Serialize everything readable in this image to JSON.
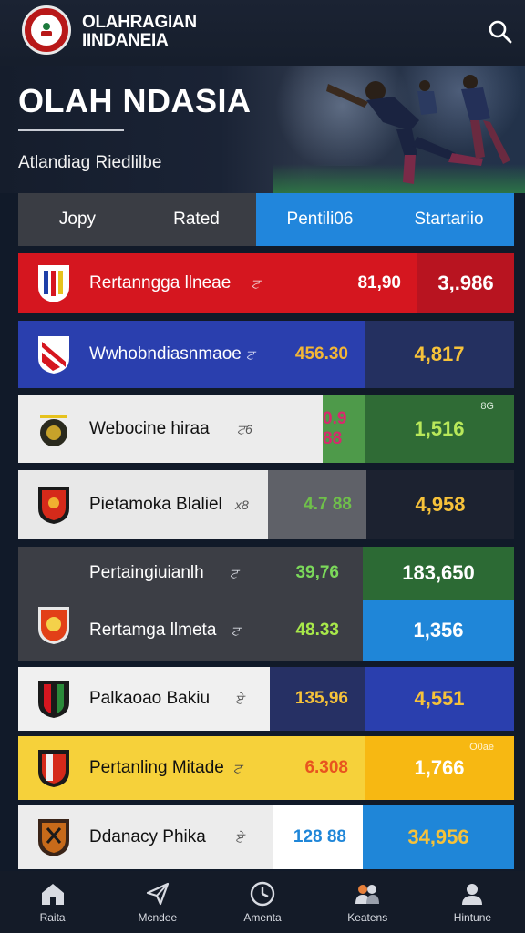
{
  "app": {
    "title_line1": "OLAHRAGIAN",
    "title_line2": "IINDANEIA"
  },
  "icons": {
    "search": "search-icon",
    "home": "home-icon",
    "matches": "paper-plane-icon",
    "schedule": "clock-icon",
    "teams": "users-icon",
    "profile": "person-icon"
  },
  "hero": {
    "title": "OLAH NDASIA",
    "subtitle": "Atlandiag Riedlilbe"
  },
  "table": {
    "headers": [
      "Jopy",
      "Rated",
      "Pentili06",
      "Startariio"
    ],
    "rows": [
      {
        "name": "Rertanngga llneae",
        "code": "ਟ",
        "value": "81,90",
        "score": "3,.986",
        "label": ""
      },
      {
        "name": "Wwhobndiasnmaoe",
        "code": "ਟ",
        "value": "456.30",
        "score": "4,817",
        "label": ""
      },
      {
        "name": "Webocine hiraa",
        "code": "ਟ6",
        "value": "0.9 88",
        "score": "1,516",
        "label": "8G"
      },
      {
        "name": "Pietamoka Blaliel",
        "code": "x8",
        "value": "4.7 88",
        "score": "4,958",
        "label": ""
      },
      {
        "name": "Pertaingiuianlh",
        "code": "ਟ",
        "value": "39,76",
        "score": "183,650",
        "label": ""
      },
      {
        "name": "Rertamga llmeta",
        "code": "ਟ",
        "value": "48.33",
        "score": "1,356",
        "label": ""
      },
      {
        "name": "Palkaoao Bakiu",
        "code": "ਏ",
        "value": "135,96",
        "score": "4,551",
        "label": ""
      },
      {
        "name": "Pertanling Mitade",
        "code": "ਟ",
        "value": "6.308",
        "score": "1,766",
        "label": "O0ae"
      },
      {
        "name": "Ddanacy Phika",
        "code": "ਏ",
        "value": "128 88",
        "score": "34,956",
        "label": ""
      }
    ]
  },
  "nav": {
    "items": [
      "Raita",
      "Mcndee",
      "Amenta",
      "Keatens",
      "Hintune"
    ]
  },
  "colors": {
    "accent_blue": "#2186dc",
    "red": "#d5161f",
    "navy_blue": "#2a3fae",
    "yellow": "#f6d13a",
    "green": "#3f8a3e"
  }
}
